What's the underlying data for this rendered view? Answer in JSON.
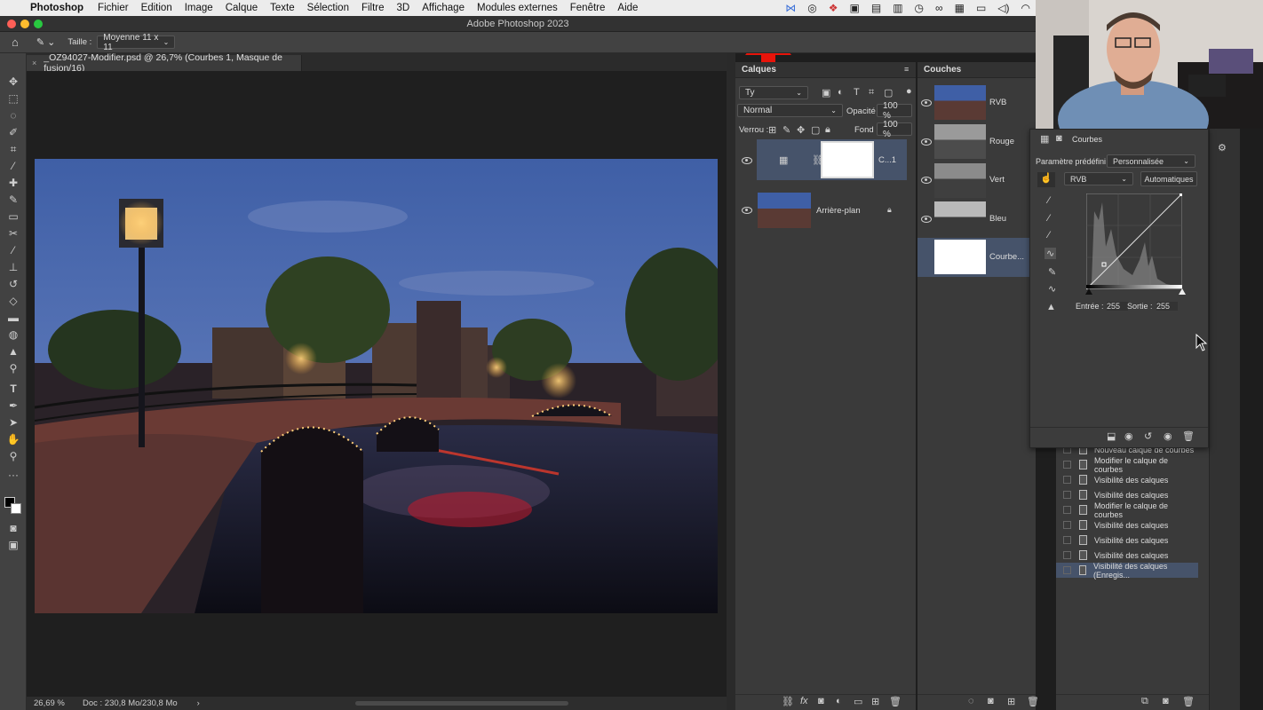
{
  "menubar": {
    "app": "Photoshop",
    "items": [
      "Fichier",
      "Edition",
      "Image",
      "Calque",
      "Texte",
      "Sélection",
      "Filtre",
      "3D",
      "Affichage",
      "Modules externes",
      "Fenêtre",
      "Aide"
    ]
  },
  "window": {
    "title": "Adobe Photoshop 2023"
  },
  "options": {
    "size_label": "Taille :",
    "size_value": "Moyenne 11 x 11"
  },
  "document": {
    "tab_title": "_OZ94027-Modifier.psd @ 26,7% (Courbes 1, Masque de fusion/16)",
    "zoom": "26,69 %",
    "doc_info": "Doc : 230,8 Mo/230,8 Mo"
  },
  "layers_panel": {
    "tab": "Calques",
    "filter": "Ty",
    "blend_mode": "Normal",
    "opacity_label": "Opacité :",
    "opacity": "100 %",
    "lock_label": "Verrou :",
    "fill_label": "Fond :",
    "fill": "100 %",
    "layers": [
      {
        "name": "C...1",
        "selected": true
      },
      {
        "name": "Arrière-plan",
        "selected": false
      }
    ]
  },
  "channels_panel": {
    "tab": "Couches",
    "channels": [
      {
        "name": "RVB"
      },
      {
        "name": "Rouge"
      },
      {
        "name": "Vert"
      },
      {
        "name": "Bleu"
      },
      {
        "name": "Courbe..."
      }
    ]
  },
  "properties_panel": {
    "title": "Courbes",
    "preset_label": "Paramètre prédéfini :",
    "preset_value": "Personnalisée",
    "channel": "RVB",
    "auto_button": "Automatiques",
    "input_label": "Entrée :",
    "input_value": "255",
    "output_label": "Sortie :",
    "output_value": "255"
  },
  "history_panel": {
    "items": [
      "Nouveau calque de courbes",
      "Modifier le calque de courbes",
      "Visibilité des calques",
      "Visibilité des calques",
      "Modifier le calque de courbes",
      "Visibilité des calques",
      "Visibilité des calques",
      "Visibilité des calques",
      "Visibilité des calques (Enregis..."
    ]
  },
  "colors": {
    "accent_arrow": "#e8140a",
    "selection": "#46536a"
  }
}
